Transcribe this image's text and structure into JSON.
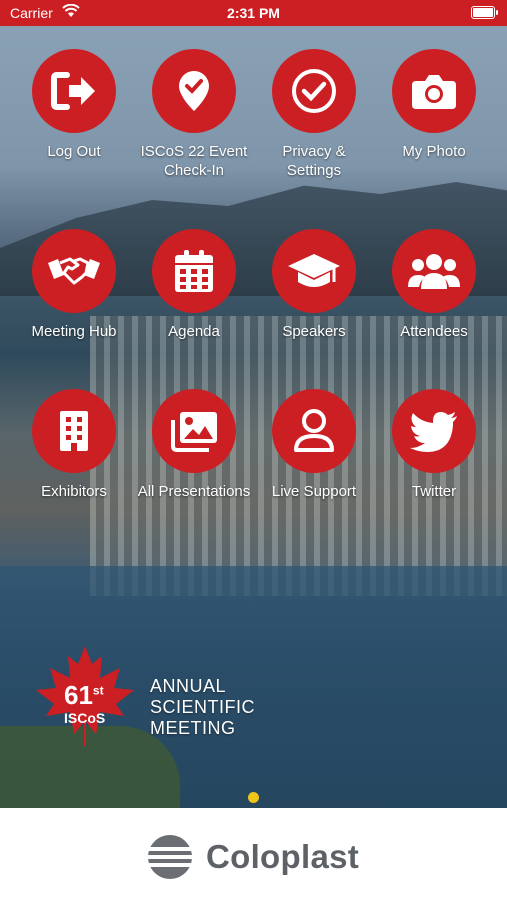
{
  "status": {
    "carrier": "Carrier",
    "time": "2:31 PM"
  },
  "tiles": [
    {
      "label": "Log Out",
      "icon": "logout-icon"
    },
    {
      "label": "ISCoS 22 Event Check-In",
      "icon": "location-check-icon"
    },
    {
      "label": "Privacy & Settings",
      "icon": "check-circle-icon"
    },
    {
      "label": "My Photo",
      "icon": "camera-icon"
    },
    {
      "label": "Meeting Hub",
      "icon": "handshake-icon"
    },
    {
      "label": "Agenda",
      "icon": "calendar-icon"
    },
    {
      "label": "Speakers",
      "icon": "graduation-cap-icon"
    },
    {
      "label": "Attendees",
      "icon": "people-icon"
    },
    {
      "label": "Exhibitors",
      "icon": "building-icon"
    },
    {
      "label": "All Presentations",
      "icon": "images-icon"
    },
    {
      "label": "Live Support",
      "icon": "person-icon"
    },
    {
      "label": "Twitter",
      "icon": "twitter-icon"
    }
  ],
  "event_logo": {
    "number": "61",
    "suffix": "st",
    "org": "ISCoS",
    "title_line1": "ANNUAL",
    "title_line2": "SCIENTIFIC",
    "title_line3": "MEETING"
  },
  "sponsor": {
    "name": "Coloplast"
  },
  "colors": {
    "accent": "#cc1f24",
    "page_dot": "#f0c419",
    "sponsor_text": "#5e6266"
  }
}
